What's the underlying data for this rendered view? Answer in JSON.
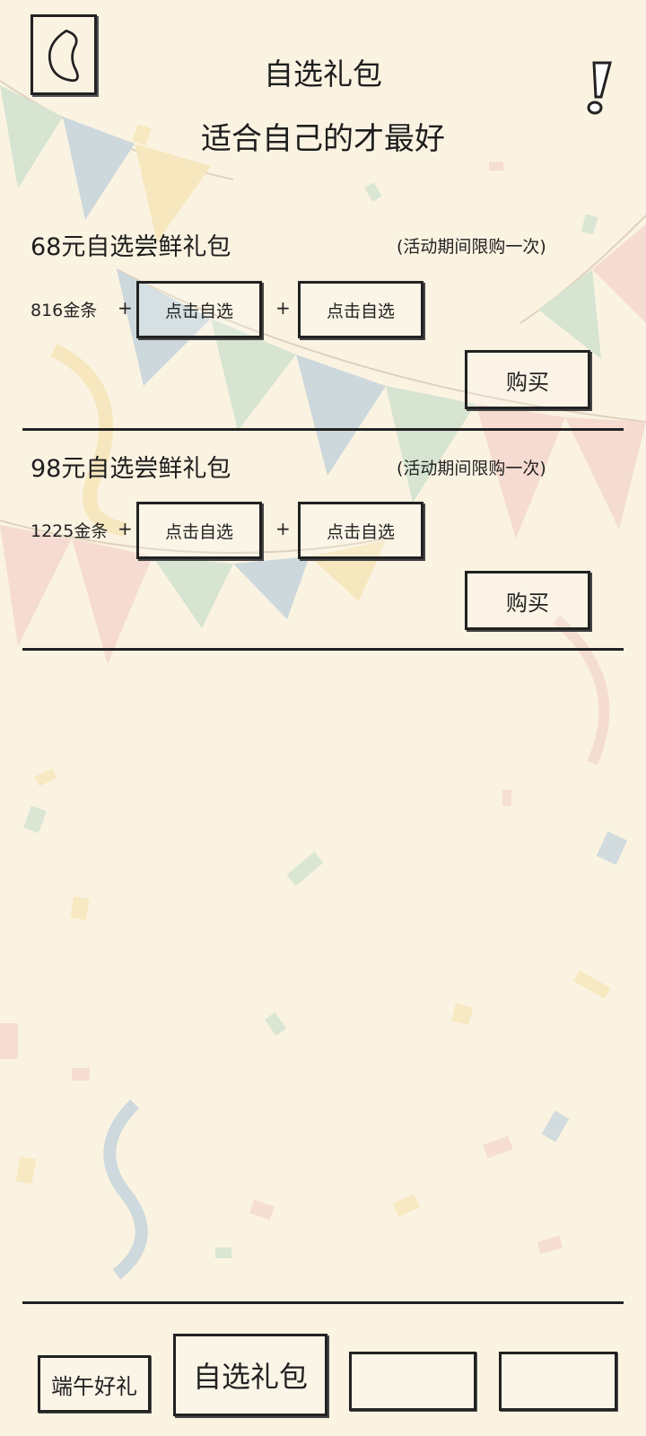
{
  "header": {
    "back_icon": "back-arrow-icon",
    "title": "自选礼包",
    "subtitle": "适合自己的才最好",
    "alert_icon": "exclamation-icon"
  },
  "packs": [
    {
      "name": "68元自选尝鲜礼包",
      "limit": "(活动期间限购一次)",
      "gold": "816金条",
      "plus": "+",
      "pick1": "点击自选",
      "pick2": "点击自选",
      "buy": "购买"
    },
    {
      "name": "98元自选尝鲜礼包",
      "limit": "(活动期间限购一次)",
      "gold": "1225金条",
      "plus": "+",
      "pick1": "点击自选",
      "pick2": "点击自选",
      "buy": "购买"
    }
  ],
  "tabs": [
    {
      "label": "端午好礼",
      "selected": false
    },
    {
      "label": "自选礼包",
      "selected": true
    },
    {
      "label": "",
      "selected": false
    },
    {
      "label": "",
      "selected": false
    }
  ],
  "colors": {
    "background": "#fbf3e2",
    "ink": "#1e1e1e",
    "flag_green": "#b9d9c4",
    "flag_blue": "#a9c3d8",
    "flag_pink": "#f1c9c4",
    "flag_yellow": "#f3dfa1"
  }
}
